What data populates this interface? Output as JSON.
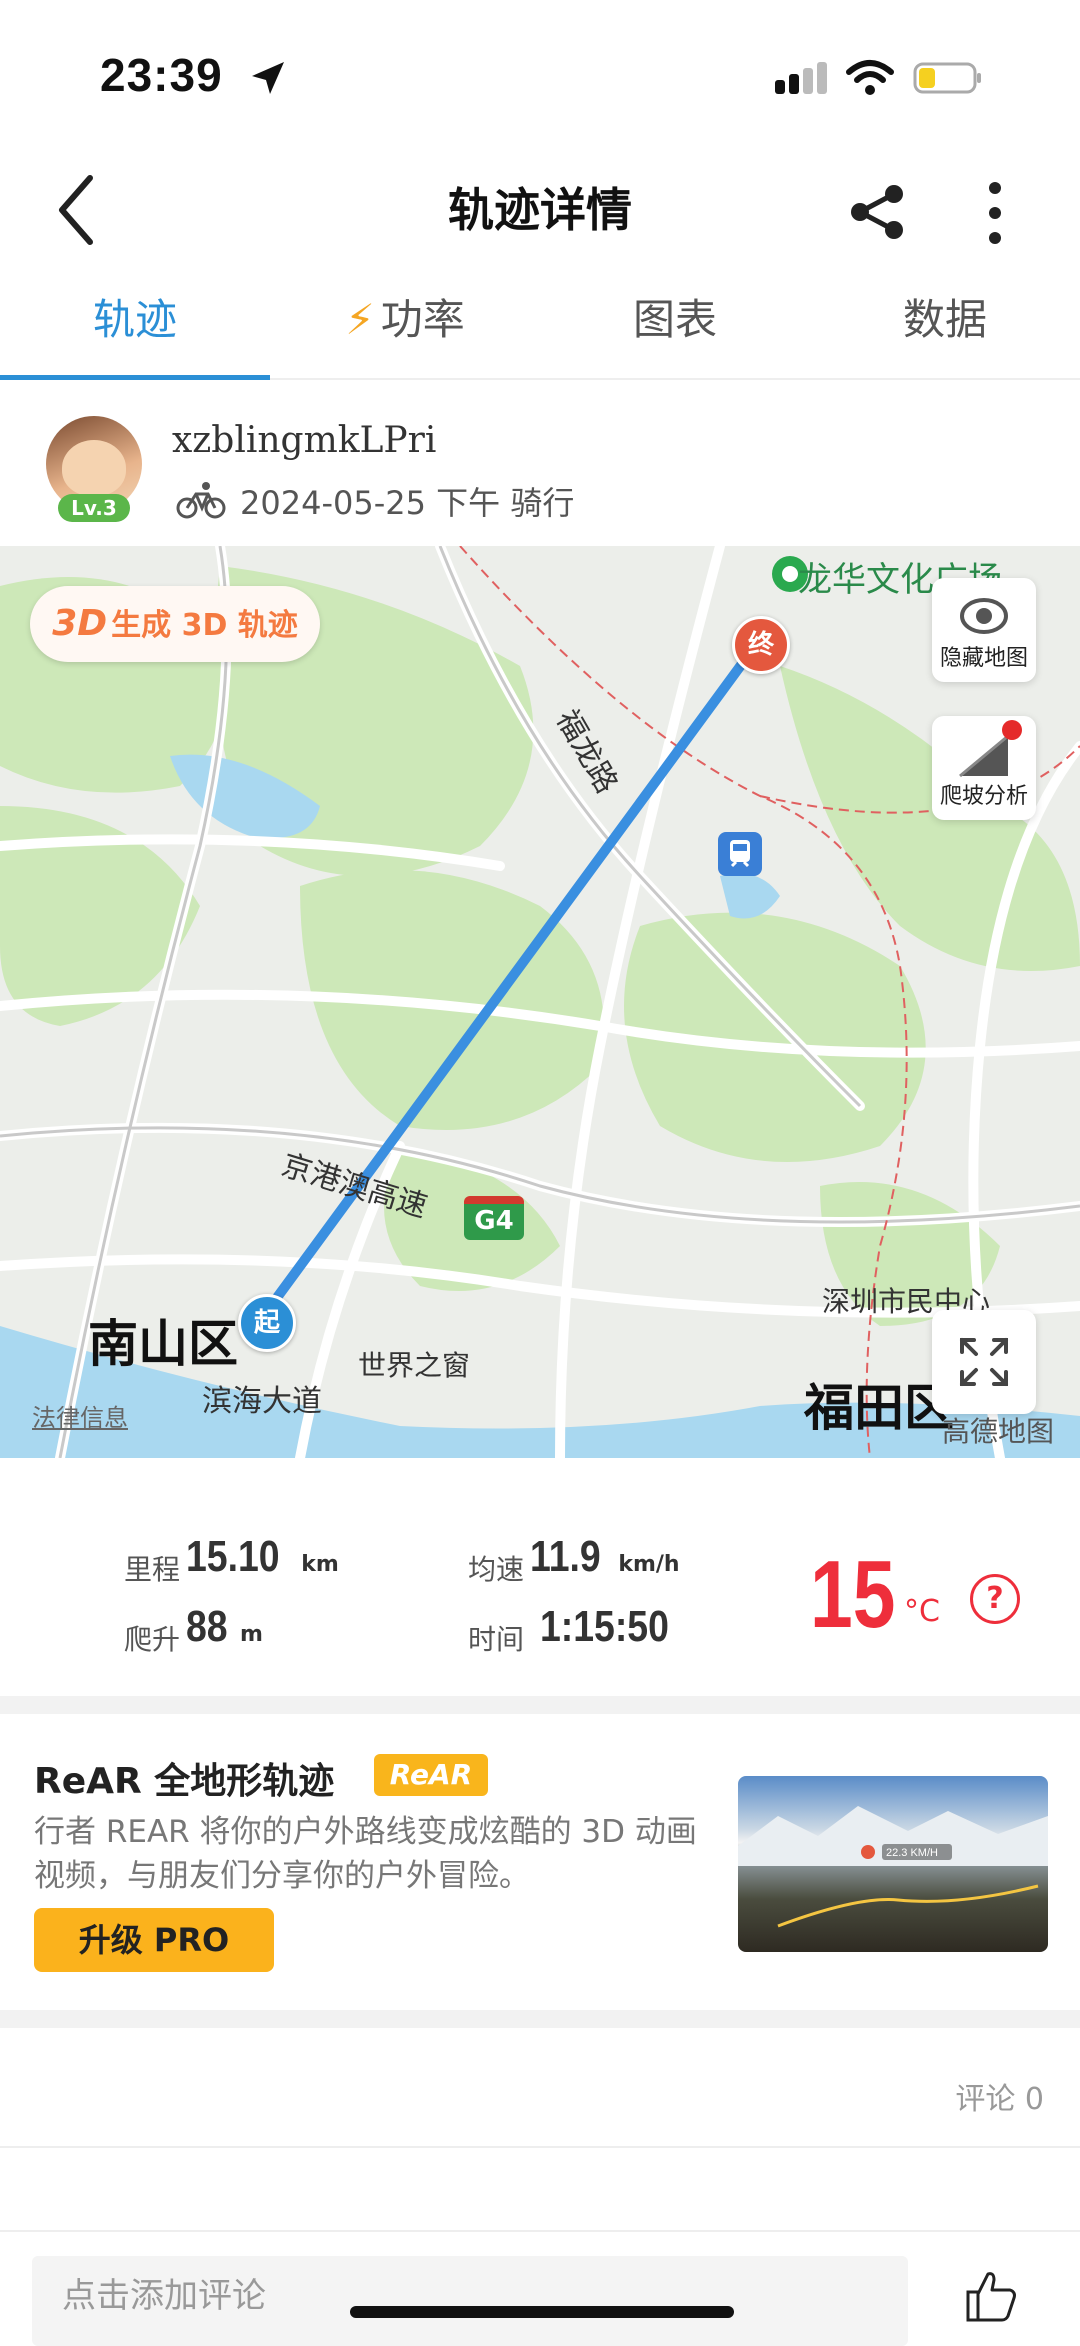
{
  "status": {
    "time": "23:39"
  },
  "header": {
    "title": "轨迹详情"
  },
  "tabs": [
    {
      "label": "轨迹",
      "active": true
    },
    {
      "label": "功率",
      "icon": "bolt-icon"
    },
    {
      "label": "图表"
    },
    {
      "label": "数据"
    }
  ],
  "user": {
    "name": "xzblingmkLPri",
    "level": "Lv.3",
    "meta": "2024-05-25 下午  骑行"
  },
  "map": {
    "btn_3d_prefix": "3D",
    "btn_3d": "生成 3D 轨迹",
    "hide_map": "隐藏地图",
    "climb": "爬坡分析",
    "legal": "法律信息",
    "provider": "高德地图",
    "start_marker": "起",
    "end_marker": "终",
    "labels": {
      "longhua": "龙华文化广场",
      "fulong": "福龙路",
      "jinggang": "京港澳高速",
      "g4": "G4",
      "nanshan": "南山区",
      "binhai": "滨海大道",
      "shijie": "世界之窗",
      "shimin": "深圳市民中心",
      "futian": "福田区"
    },
    "colors": {
      "route": "#3a8fe0",
      "green": "#cde8b8",
      "water": "#a9d8f0",
      "road": "#ffffff"
    }
  },
  "stats": {
    "distance": {
      "label": "里程",
      "value": "15.10",
      "unit": "km"
    },
    "speed": {
      "label": "均速",
      "value": "11.9",
      "unit": "km/h"
    },
    "climb": {
      "label": "爬升",
      "value": "88",
      "unit": "m"
    },
    "time": {
      "label": "时间",
      "value": "1:15:50"
    },
    "temperature": {
      "value": "15",
      "unit": "°C"
    }
  },
  "promo": {
    "title": "ReAR 全地形轨迹",
    "badge": "ReAR",
    "desc": "行者 REAR 将你的户外路线变成炫酷的 3D 动画视频，与朋友们分享你的户外冒险。",
    "button": "升级 PRO",
    "image_speed": "22.3 KM/H"
  },
  "comments": {
    "count_label": "评论 0",
    "placeholder": "点击添加评论"
  }
}
